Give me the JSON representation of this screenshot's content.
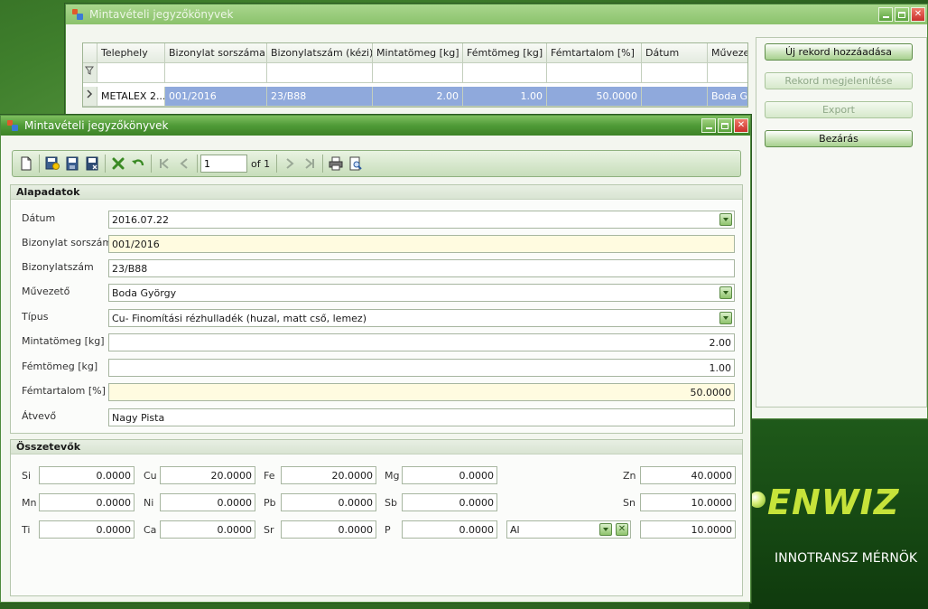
{
  "brand": {
    "logo_text": "ENWIZ",
    "tagline": "INNOTRANSZ MÉRNÖK"
  },
  "back_window": {
    "title": "Mintavételi jegyzőkönyvek",
    "grid": {
      "headers": [
        "Telephely",
        "Bizonylat sorszáma",
        "Bizonylatszám (kézi)",
        "Mintatömeg [kg]",
        "Fémtömeg [kg]",
        "Fémtartalom [%]",
        "Dátum",
        "Művezető"
      ],
      "filter_icon": "filter-icon",
      "rows": [
        [
          "METALEX 2...",
          "001/2016",
          "23/B88",
          "2.00",
          "1.00",
          "50.0000",
          "",
          "Boda György"
        ]
      ]
    },
    "buttons": {
      "add_record": "Új rekord hozzáadása",
      "show_record": "Rekord megjelenítése",
      "export": "Export",
      "close": "Bezárás"
    }
  },
  "front_window": {
    "title": "Mintavételi jegyzőkönyvek",
    "toolbar": {
      "page_value": "1",
      "page_of": "of 1"
    },
    "basic": {
      "title": "Alapadatok",
      "date_label": "Dátum",
      "date_value": "2016.07.22",
      "doc_serial_label": "Bizonylat sorszáma",
      "doc_serial_value": "001/2016",
      "doc_number_label": "Bizonylatszám",
      "doc_number_value": "23/B88",
      "foreman_label": "Művezető",
      "foreman_value": "Boda György",
      "type_label": "Típus",
      "type_value": "Cu- Finomítási rézhulladék (huzal, matt cső, lemez)",
      "sample_mass_label": "Mintatömeg [kg]",
      "sample_mass_value": "2.00",
      "metal_mass_label": "Fémtömeg [kg]",
      "metal_mass_value": "1.00",
      "metal_content_label": "Fémtartalom [%]",
      "metal_content_value": "50.0000",
      "receiver_label": "Átvevő",
      "receiver_value": "Nagy Pista"
    },
    "components": {
      "title": "Összetevők",
      "row1": [
        {
          "label": "Si",
          "value": "0.0000"
        },
        {
          "label": "Cu",
          "value": "20.0000"
        },
        {
          "label": "Fe",
          "value": "20.0000"
        },
        {
          "label": "Mg",
          "value": "0.0000"
        },
        {
          "label": "Zn",
          "value": "40.0000"
        }
      ],
      "row2": [
        {
          "label": "Mn",
          "value": "0.0000"
        },
        {
          "label": "Ni",
          "value": "0.0000"
        },
        {
          "label": "Pb",
          "value": "0.0000"
        },
        {
          "label": "Sb",
          "value": "0.0000"
        },
        {
          "label": "Sn",
          "value": "10.0000"
        }
      ],
      "row3": [
        {
          "label": "Ti",
          "value": "0.0000"
        },
        {
          "label": "Ca",
          "value": "0.0000"
        },
        {
          "label": "Sr",
          "value": "0.0000"
        },
        {
          "label": "P",
          "value": "0.0000"
        }
      ],
      "extra_select_value": "Al",
      "extra_value": "10.0000"
    }
  }
}
